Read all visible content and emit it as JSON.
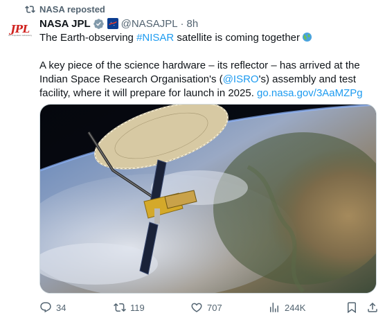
{
  "repost": {
    "label": "NASA reposted",
    "icon": "repost-icon"
  },
  "author": {
    "avatar_text": "JPL",
    "avatar_sub": "Jet Propulsion Laboratory",
    "display_name": "NASA JPL",
    "handle": "@NASAJPL",
    "separator": "·",
    "time": "8h"
  },
  "tweet": {
    "line1_prefix": "The Earth-observing ",
    "line1_hashtag": "#NISAR",
    "line1_suffix": " satellite is coming together",
    "para2_a": "A key piece of the science hardware – its reflector – has arrived at the Indian Space Research Organisation's (",
    "para2_mention": "@ISRO",
    "para2_b": "'s) assembly and test facility, where it will prepare for launch in 2025. ",
    "para2_link": "go.nasa.gov/3AaMZPg"
  },
  "actions": {
    "replies": "34",
    "reposts": "119",
    "likes": "707",
    "views": "244K"
  },
  "colors": {
    "accent": "#1d9bf0",
    "secondary_text": "#536471",
    "primary_text": "#0f1419",
    "jpl_red": "#d0221f"
  }
}
